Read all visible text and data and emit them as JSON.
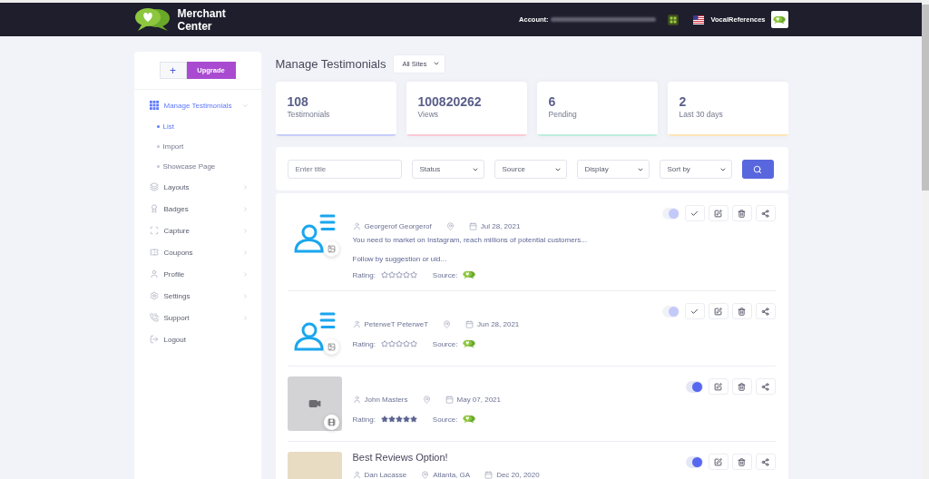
{
  "header": {
    "brand": "Merchant Center",
    "account_label": "Account:",
    "account_name": "VocalReferences"
  },
  "sidebar": {
    "add_button": "+",
    "upgrade_button": "Upgrade",
    "items": [
      {
        "label": "Manage Testimonials",
        "selected": true,
        "expanded": true,
        "children": [
          {
            "label": "List",
            "selected": true
          },
          {
            "label": "Import",
            "selected": false
          },
          {
            "label": "Showcase Page",
            "selected": false
          }
        ]
      },
      {
        "label": "Layouts",
        "selected": false,
        "expanded": false
      },
      {
        "label": "Badges",
        "selected": false,
        "expanded": false
      },
      {
        "label": "Capture",
        "selected": false,
        "expanded": false
      },
      {
        "label": "Coupons",
        "selected": false,
        "expanded": false
      },
      {
        "label": "Profile",
        "selected": false,
        "expanded": false
      },
      {
        "label": "Settings",
        "selected": false,
        "expanded": false
      },
      {
        "label": "Support",
        "selected": false,
        "expanded": false
      },
      {
        "label": "Logout",
        "selected": false
      }
    ]
  },
  "page": {
    "title": "Manage Testimonials",
    "site_filter": "All Sites"
  },
  "stats": [
    {
      "value": "108",
      "label": "Testimonials",
      "color": "#c7cdfa"
    },
    {
      "value": "100820262",
      "label": "Views",
      "color": "#fbc9d4"
    },
    {
      "value": "6",
      "label": "Pending",
      "color": "#bdeedf"
    },
    {
      "value": "2",
      "label": "Last 30 days",
      "color": "#fde5b5"
    }
  ],
  "filters": {
    "title_placeholder": "Enter title",
    "dropdowns": [
      "Status",
      "Source",
      "Display",
      "Sort by"
    ]
  },
  "testimonials": [
    {
      "kind": "image",
      "disabled": true,
      "pending": true,
      "author": "Georgerof Georgerof",
      "date": "Jul 28, 2021",
      "text": [
        "You need to market on Instagram, reach millions of potential customers...",
        "Follow by suggestion or uid..."
      ],
      "rating_label": "Rating:",
      "stars": 0,
      "source_label": "Source:"
    },
    {
      "kind": "image",
      "disabled": true,
      "pending": true,
      "author": "PeterweT PeterweT",
      "date": "Jun 28, 2021",
      "rating_label": "Rating:",
      "stars": 0,
      "source_label": "Source:"
    },
    {
      "kind": "video",
      "disabled": false,
      "pending": false,
      "author": "John Masters",
      "date": "May 07, 2021",
      "rating_label": "Rating:",
      "stars": 5,
      "source_label": "Source:"
    },
    {
      "kind": "photo",
      "disabled": false,
      "pending": false,
      "title": "Best Reviews Option!",
      "author": "Dan Lacasse",
      "location": "Atlanta, GA",
      "date": "Dec 20, 2020"
    }
  ]
}
